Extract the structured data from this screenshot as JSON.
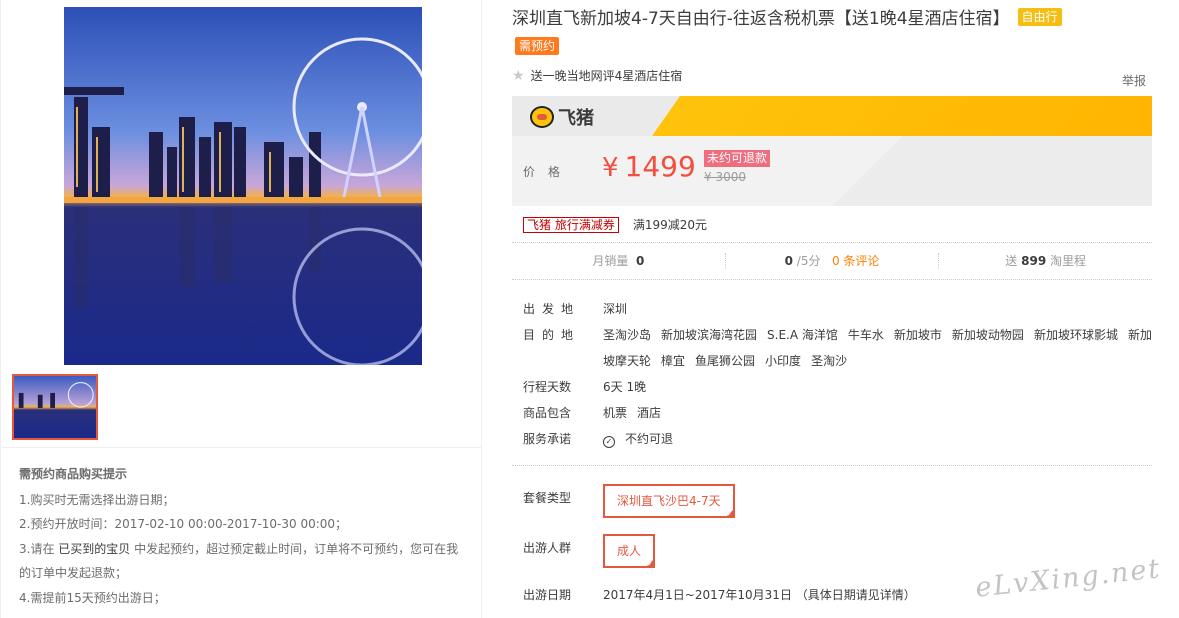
{
  "product": {
    "title": "深圳直飞新加坡4-7天自由行-往返含税机票【送1晚4星酒店住宿】",
    "tag_type": "自由行",
    "tag_reserve": "需预约",
    "subtitle": "送一晚当地网评4星酒店住宿",
    "report": "举报"
  },
  "brand": {
    "name": "飞猪"
  },
  "price": {
    "label": "价格",
    "currency": "¥",
    "value": "1499",
    "badge": "未约可退款",
    "original": "¥ 3000"
  },
  "coupon": {
    "tag": "飞猪 旅行满减券",
    "text": "满199减20元"
  },
  "stats": {
    "sales_label": "月销量",
    "sales_value": "0",
    "rating_value": "0",
    "rating_suffix": " /5分",
    "reviews": "0 条评论",
    "miles_prefix": "送",
    "miles_value": "899",
    "miles_suffix": "淘里程"
  },
  "attrs": {
    "depart_label": "出发地",
    "depart_value": "深圳",
    "dest_label": "目的地",
    "destinations": [
      "圣淘沙岛",
      "新加坡滨海湾花园",
      "S.E.A 海洋馆",
      "牛车水",
      "新加坡市",
      "新加坡动物园",
      "新加坡环球影城",
      "新加坡摩天轮",
      "樟宜",
      "鱼尾狮公园",
      "小印度",
      "圣淘沙"
    ],
    "days_label": "行程天数",
    "days_value": "6天 1晚",
    "include_label": "商品包含",
    "include_values": [
      "机票",
      "酒店"
    ],
    "promise_label": "服务承诺",
    "promise_value": "不约可退"
  },
  "options": {
    "package_label": "套餐类型",
    "package_value": "深圳直飞沙巴4-7天",
    "people_label": "出游人群",
    "people_value": "成人",
    "date_label": "出游日期",
    "date_value": "2017年4月1日~2017年10月31日 （具体日期请见详情）"
  },
  "notice": {
    "title": "需预约商品购买提示",
    "line1": "1.购买时无需选择出游日期；",
    "line2": "2.预约开放时间：2017-02-10 00:00-2017-10-30 00:00；",
    "line3a": "3.请在 ",
    "line3b": "已买到的宝贝",
    "line3c": " 中发起预约，超过预定截止时间，订单将不可预约，您可在我的订单中发起退款；",
    "line4": "4.需提前15天预约出游日；"
  },
  "watermark": "eLvXing.net",
  "colors": {
    "accent": "#e4583e",
    "price": "#f54d3f",
    "brand_yellow": "#ffc30c",
    "tag_yellow": "#f6be12",
    "tag_orange": "#ff7a1e"
  }
}
